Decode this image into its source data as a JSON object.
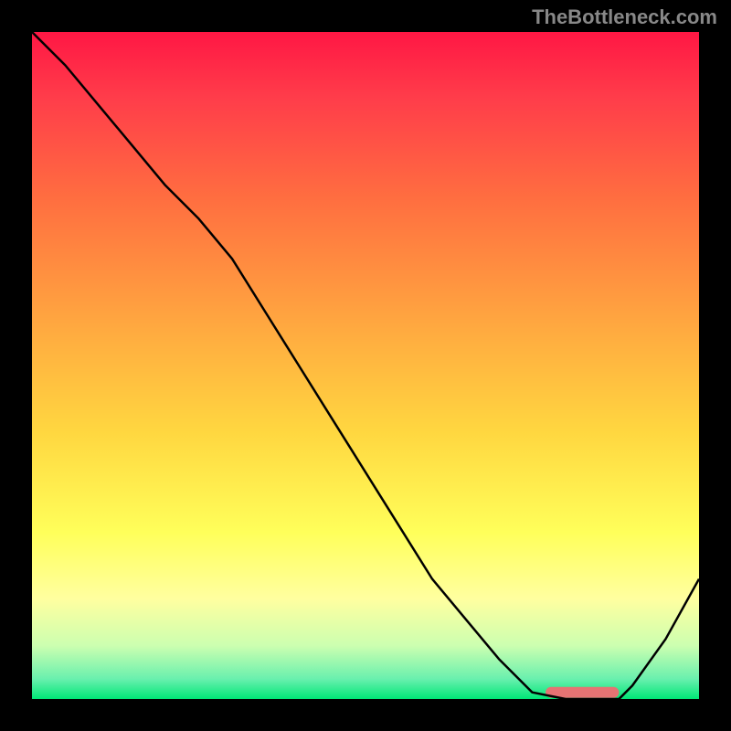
{
  "watermark": "TheBottleneck.com",
  "chart_data": {
    "type": "line",
    "title": "",
    "xlabel": "",
    "ylabel": "",
    "x": [
      0,
      5,
      10,
      15,
      20,
      25,
      30,
      35,
      40,
      45,
      50,
      55,
      60,
      65,
      70,
      75,
      80,
      82,
      85,
      88,
      90,
      95,
      100
    ],
    "values": [
      100,
      95,
      89,
      83,
      77,
      72,
      66,
      58,
      50,
      42,
      34,
      26,
      18,
      12,
      6,
      1,
      0,
      0,
      0,
      0,
      2,
      9,
      18
    ],
    "xlim": [
      0,
      100
    ],
    "ylim": [
      0,
      100
    ],
    "annotation": {
      "x_start": 77,
      "x_end": 88,
      "y": 1,
      "color": "#e57373"
    },
    "background": {
      "type": "vertical-gradient",
      "stops": [
        {
          "offset": 0,
          "color": "#ff1744"
        },
        {
          "offset": 10,
          "color": "#ff3d4a"
        },
        {
          "offset": 25,
          "color": "#ff6e40"
        },
        {
          "offset": 45,
          "color": "#ffab40"
        },
        {
          "offset": 60,
          "color": "#ffd740"
        },
        {
          "offset": 75,
          "color": "#ffff5a"
        },
        {
          "offset": 85,
          "color": "#ffffa0"
        },
        {
          "offset": 92,
          "color": "#ccffb0"
        },
        {
          "offset": 97,
          "color": "#69f0ae"
        },
        {
          "offset": 100,
          "color": "#00e676"
        }
      ]
    }
  }
}
